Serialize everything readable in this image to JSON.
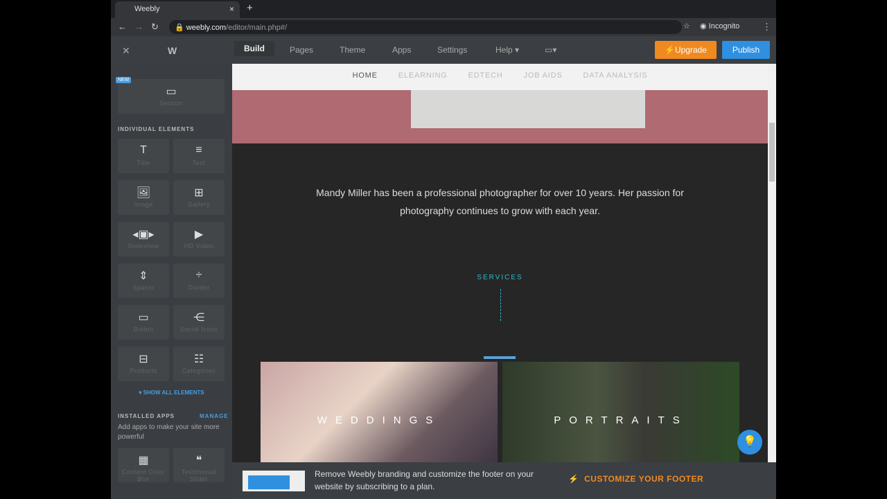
{
  "browser": {
    "tab_title": "Weebly",
    "url_host": "weebly.com",
    "url_path": "/editor/main.php#/",
    "profile": "Incognito"
  },
  "toolbar": {
    "tabs": [
      "Build",
      "Pages",
      "Theme",
      "Apps",
      "Settings",
      "Help ▾"
    ],
    "upgrade": "Upgrade",
    "publish": "Publish"
  },
  "sidebar": {
    "new_badge": "NEW",
    "section": "Section",
    "individual_header": "INDIVIDUAL ELEMENTS",
    "elements": [
      {
        "label": "Title",
        "icon": "T"
      },
      {
        "label": "Text",
        "icon": "≡"
      },
      {
        "label": "Image",
        "icon": "🖼"
      },
      {
        "label": "Gallery",
        "icon": "⊞"
      },
      {
        "label": "Slideshow",
        "icon": "◂▣▸"
      },
      {
        "label": "HD Video",
        "icon": "▶"
      },
      {
        "label": "Spacer",
        "icon": "⇕"
      },
      {
        "label": "Divider",
        "icon": "÷"
      },
      {
        "label": "Button",
        "icon": "▭"
      },
      {
        "label": "Social Icons",
        "icon": "⋲"
      },
      {
        "label": "Products",
        "icon": "⊟"
      },
      {
        "label": "Categories",
        "icon": "☷"
      }
    ],
    "show_all": "SHOW ALL ELEMENTS",
    "installed_header": "INSTALLED APPS",
    "manage": "MANAGE",
    "installed_desc": "Add apps to make your site more powerful",
    "apps": [
      {
        "label": "Content Color Box",
        "icon": "▦"
      },
      {
        "label": "Testimonial Slider",
        "icon": "❝"
      }
    ]
  },
  "site": {
    "nav": [
      "HOME",
      "ELEARNING",
      "EDTECH",
      "JOB AIDS",
      "DATA ANALYSIS"
    ],
    "intro": "Mandy Miller has been a professional photographer for over 10 years. Her passion for photography continues to grow with each year.",
    "services": "SERVICES",
    "tiles": [
      "WEDDINGS",
      "PORTRAITS"
    ]
  },
  "footer": {
    "text": "Remove Weebly branding and customize the footer on your website by subscribing to a plan.",
    "cta": "CUSTOMIZE YOUR FOOTER"
  }
}
